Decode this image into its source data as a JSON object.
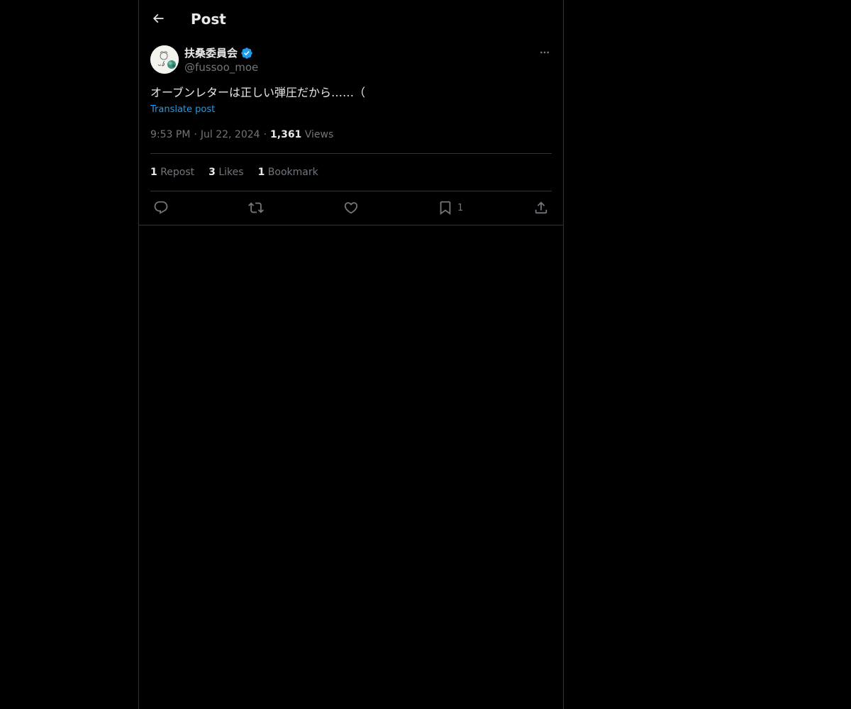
{
  "header": {
    "title": "Post",
    "back_icon": "arrow-left-icon"
  },
  "post": {
    "author_name": "扶桑委員会",
    "verified_icon": "verified-badge-icon",
    "handle": "@fussoo_moe",
    "text": "オーブンレターは正しい弾圧だから……（",
    "translate_label": "Translate post",
    "time": "9:53 PM",
    "date": "Jul 22, 2024",
    "views_count": "1,361",
    "views_label": "Views",
    "separator": "·"
  },
  "stats": {
    "reposts_count": "1",
    "reposts_label": "Repost",
    "likes_count": "3",
    "likes_label": "Likes",
    "bookmarks_count": "1",
    "bookmarks_label": "Bookmark"
  },
  "actions": {
    "reply_icon": "reply-icon",
    "repost_icon": "repost-icon",
    "like_icon": "heart-icon",
    "bookmark_icon": "bookmark-icon",
    "bookmark_count": "1",
    "share_icon": "share-icon"
  },
  "colors": {
    "background": "#000000",
    "text": "#e7e9ea",
    "secondary": "#71767b",
    "accent": "#1d9bf0",
    "border": "#2f3336"
  }
}
